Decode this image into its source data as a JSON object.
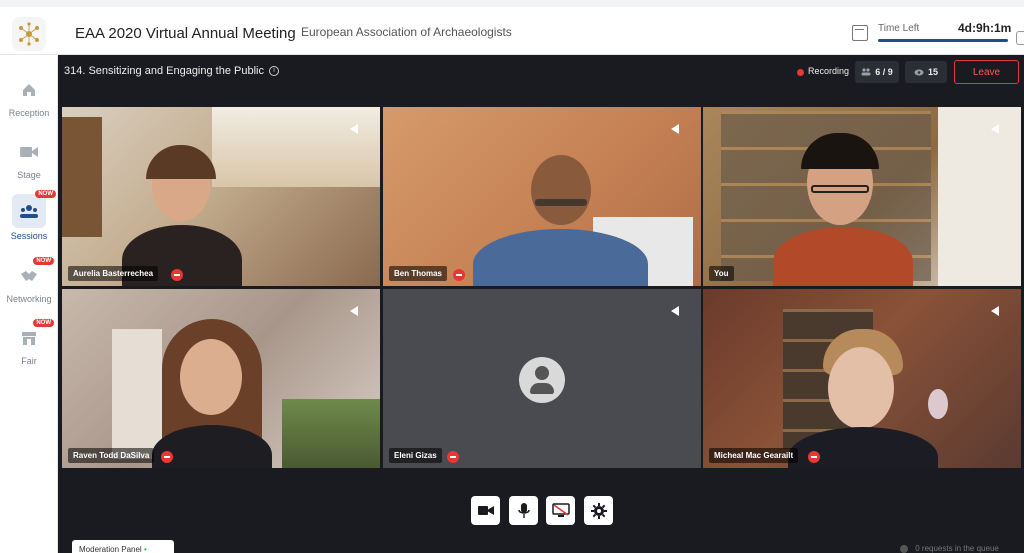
{
  "header": {
    "event_title": "EAA 2020 Virtual Annual Meeting",
    "org_name": "European Association of Archaeologists",
    "time_left_label": "Time Left",
    "time_left_value": "4d:9h:1m",
    "icons": [
      "logo",
      "calendar-icon"
    ]
  },
  "sidebar": {
    "items": [
      {
        "label": "Reception",
        "icon": "home-icon",
        "badge": ""
      },
      {
        "label": "Stage",
        "icon": "video-camera-icon",
        "badge": ""
      },
      {
        "label": "Sessions",
        "icon": "sessions-icon",
        "badge": "NOW"
      },
      {
        "label": "Networking",
        "icon": "handshake-icon",
        "badge": "NOW"
      },
      {
        "label": "Fair",
        "icon": "booth-icon",
        "badge": "NOW"
      }
    ]
  },
  "session": {
    "title": "314. Sensitizing and Engaging the Public",
    "recording_label": "Recording",
    "participants": "6 / 9",
    "viewers": "15",
    "leave_label": "Leave"
  },
  "participants": [
    {
      "name": "Aurelia Basterrechea",
      "muted": true,
      "bg": "#c9b59e"
    },
    {
      "name": "Ben Thomas",
      "muted": true,
      "bg": "#c98c5e"
    },
    {
      "name": "You",
      "muted": false,
      "bg": "#b49a7a"
    },
    {
      "name": "Raven Todd DaSilva",
      "muted": true,
      "bg": "#b8a69a"
    },
    {
      "name": "Eleni Gizas",
      "muted": true,
      "bg": "#4a4b50"
    },
    {
      "name": "Micheal Mac Gearailt",
      "muted": true,
      "bg": "#7a4a3a"
    }
  ],
  "controls": [
    "camera-icon",
    "microphone-icon",
    "screen-share-icon",
    "settings-icon"
  ],
  "moderation": {
    "panel_label": "Moderation Panel",
    "queue_text": "0 requests in the queue"
  },
  "colors": {
    "accent": "#1f4e8c",
    "stage_bg": "#1a1b20",
    "danger": "#e53935"
  }
}
